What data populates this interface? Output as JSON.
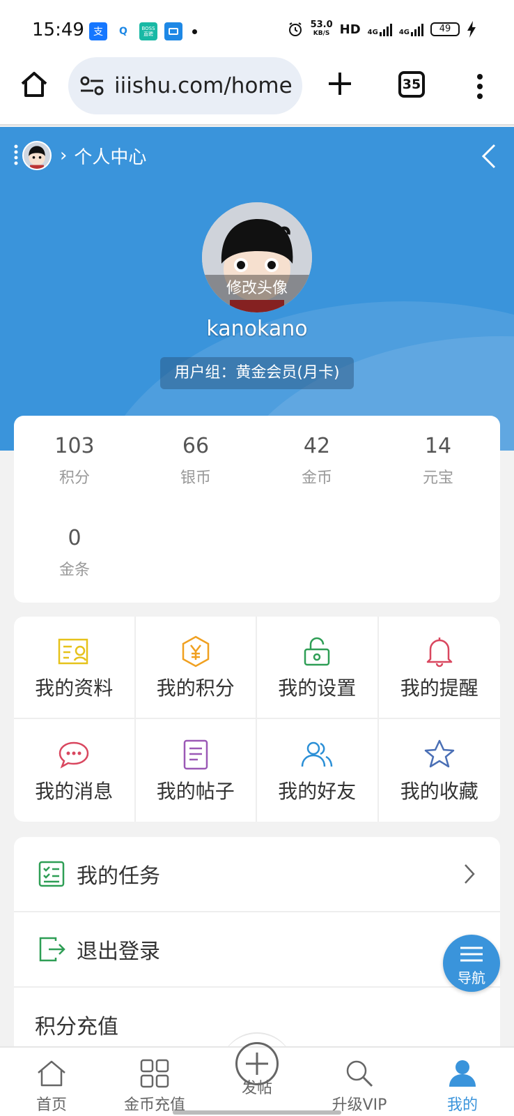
{
  "status_bar": {
    "time": "15:49",
    "app_icons": [
      {
        "label": "支",
        "color": "#1677ff"
      },
      {
        "label": "Q",
        "color": "#1e88e5"
      },
      {
        "label": "BOSS直聘",
        "color": "#19b9a5"
      },
      {
        "label": "",
        "color": "#1e88e5"
      }
    ],
    "network_speed": "53.0",
    "network_speed_unit": "KB/S",
    "hd": "HD",
    "signal_1": "4G",
    "signal_2": "4G",
    "battery": "49"
  },
  "browser": {
    "url": "iiishu.com/home",
    "tab_count": "35"
  },
  "header": {
    "breadcrumb_sep": "›",
    "title": "个人中心"
  },
  "profile": {
    "edit_avatar": "修改头像",
    "username": "kanokano",
    "user_group": "用户组：黄金会员(月卡)"
  },
  "stats": [
    {
      "value": "103",
      "label": "积分"
    },
    {
      "value": "66",
      "label": "银币"
    },
    {
      "value": "42",
      "label": "金币"
    },
    {
      "value": "14",
      "label": "元宝"
    },
    {
      "value": "0",
      "label": "金条"
    }
  ],
  "grid": [
    {
      "label": "我的资料",
      "icon": "profile-card-icon",
      "color": "#e6c21a"
    },
    {
      "label": "我的积分",
      "icon": "yen-hexagon-icon",
      "color": "#f0a020"
    },
    {
      "label": "我的设置",
      "icon": "lock-settings-icon",
      "color": "#2e9e55"
    },
    {
      "label": "我的提醒",
      "icon": "bell-icon",
      "color": "#d9475f"
    },
    {
      "label": "我的消息",
      "icon": "chat-bubble-icon",
      "color": "#d9475f"
    },
    {
      "label": "我的帖子",
      "icon": "document-icon",
      "color": "#9b59b6"
    },
    {
      "label": "我的好友",
      "icon": "friends-icon",
      "color": "#2b8fd6"
    },
    {
      "label": "我的收藏",
      "icon": "star-icon",
      "color": "#4a6fb5"
    }
  ],
  "list": [
    {
      "label": "我的任务",
      "icon": "checklist-icon",
      "color": "#2e9e55"
    },
    {
      "label": "退出登录",
      "icon": "logout-icon",
      "color": "#2e9e55"
    },
    {
      "label": "积分充值"
    }
  ],
  "float_nav": {
    "label": "导航"
  },
  "tabbar": [
    {
      "label": "首页",
      "icon": "home-icon"
    },
    {
      "label": "金币充值",
      "icon": "grid-icon"
    },
    {
      "label": "发帖",
      "icon": "plus-circle-icon"
    },
    {
      "label": "升级VIP",
      "icon": "search-icon"
    },
    {
      "label": "我的",
      "icon": "user-icon",
      "active": true
    }
  ],
  "colors": {
    "accent": "#3a94db",
    "background": "#f2f2f2"
  }
}
